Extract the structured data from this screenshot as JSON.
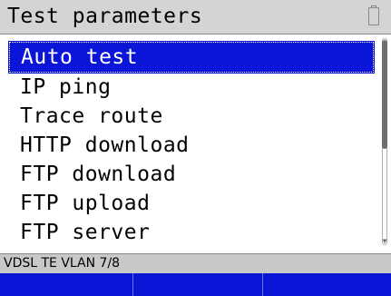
{
  "header": {
    "title": "Test parameters",
    "battery_icon": "battery-icon"
  },
  "menu": {
    "items": [
      {
        "label": "Auto test",
        "selected": true
      },
      {
        "label": "IP ping",
        "selected": false
      },
      {
        "label": "Trace route",
        "selected": false
      },
      {
        "label": "HTTP download",
        "selected": false
      },
      {
        "label": "FTP download",
        "selected": false
      },
      {
        "label": "FTP upload",
        "selected": false
      },
      {
        "label": "FTP server",
        "selected": false
      }
    ]
  },
  "status": {
    "text": "VDSL TE VLAN 7/8"
  },
  "softkeys": [
    {
      "label": ""
    },
    {
      "label": ""
    },
    {
      "label": ""
    }
  ],
  "colors": {
    "selection": "#0a15d8",
    "softkey_bar": "#0a15d8",
    "title_bar": "#d4d4d4",
    "status_bar": "#c8c8c8"
  }
}
